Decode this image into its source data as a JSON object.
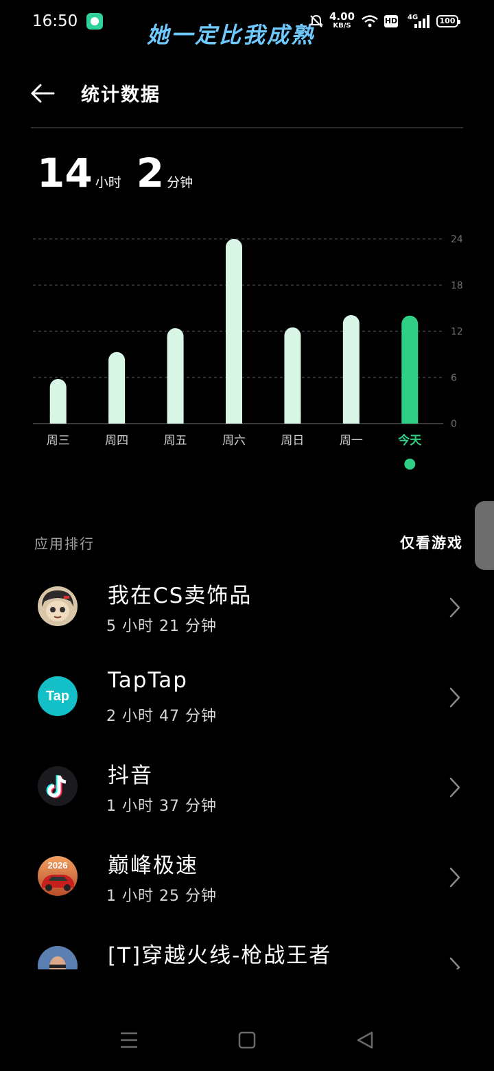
{
  "status_bar": {
    "time": "16:50",
    "banner": "她一定比我成熟",
    "speed_value": "4.00",
    "speed_unit": "KB/S",
    "hd": "HD",
    "network": "4G",
    "battery": "100"
  },
  "header": {
    "title": "统计数据"
  },
  "total": {
    "hours": "14",
    "hours_unit": "小时",
    "minutes": "2",
    "minutes_unit": "分钟"
  },
  "chart_data": {
    "type": "bar",
    "categories": [
      "周三",
      "周四",
      "周五",
      "周六",
      "周日",
      "周一",
      "今天"
    ],
    "values": [
      5.8,
      9.3,
      12.4,
      24.0,
      12.5,
      14.1,
      14.03
    ],
    "ylim": [
      0,
      24
    ],
    "yticks": [
      "24",
      "18",
      "12",
      "6",
      "0"
    ],
    "grid": true,
    "bar_color": "#d8f5e6",
    "highlight_color": "#2ecf85",
    "highlight_index": 6
  },
  "ranking": {
    "title": "应用排行",
    "games_only": "仅看游戏"
  },
  "apps": [
    {
      "name": "我在CS卖饰品",
      "time": "5 小时 21 分钟",
      "icon": "cartoon-avatar-icon"
    },
    {
      "name": "TapTap",
      "time": "2 小时 47 分钟",
      "icon": "taptap-icon",
      "icon_text": "Tap"
    },
    {
      "name": "抖音",
      "time": "1 小时 37 分钟",
      "icon": "douyin-icon"
    },
    {
      "name": "巅峰极速",
      "time": "1 小时 25 分钟",
      "icon": "racing-car-icon",
      "icon_text": "2026"
    },
    {
      "name": "[T]穿越火线-枪战王者",
      "time": "",
      "icon": "crossfire-icon"
    }
  ],
  "colors": {
    "background": "#000000",
    "accent": "#2ecf85"
  }
}
